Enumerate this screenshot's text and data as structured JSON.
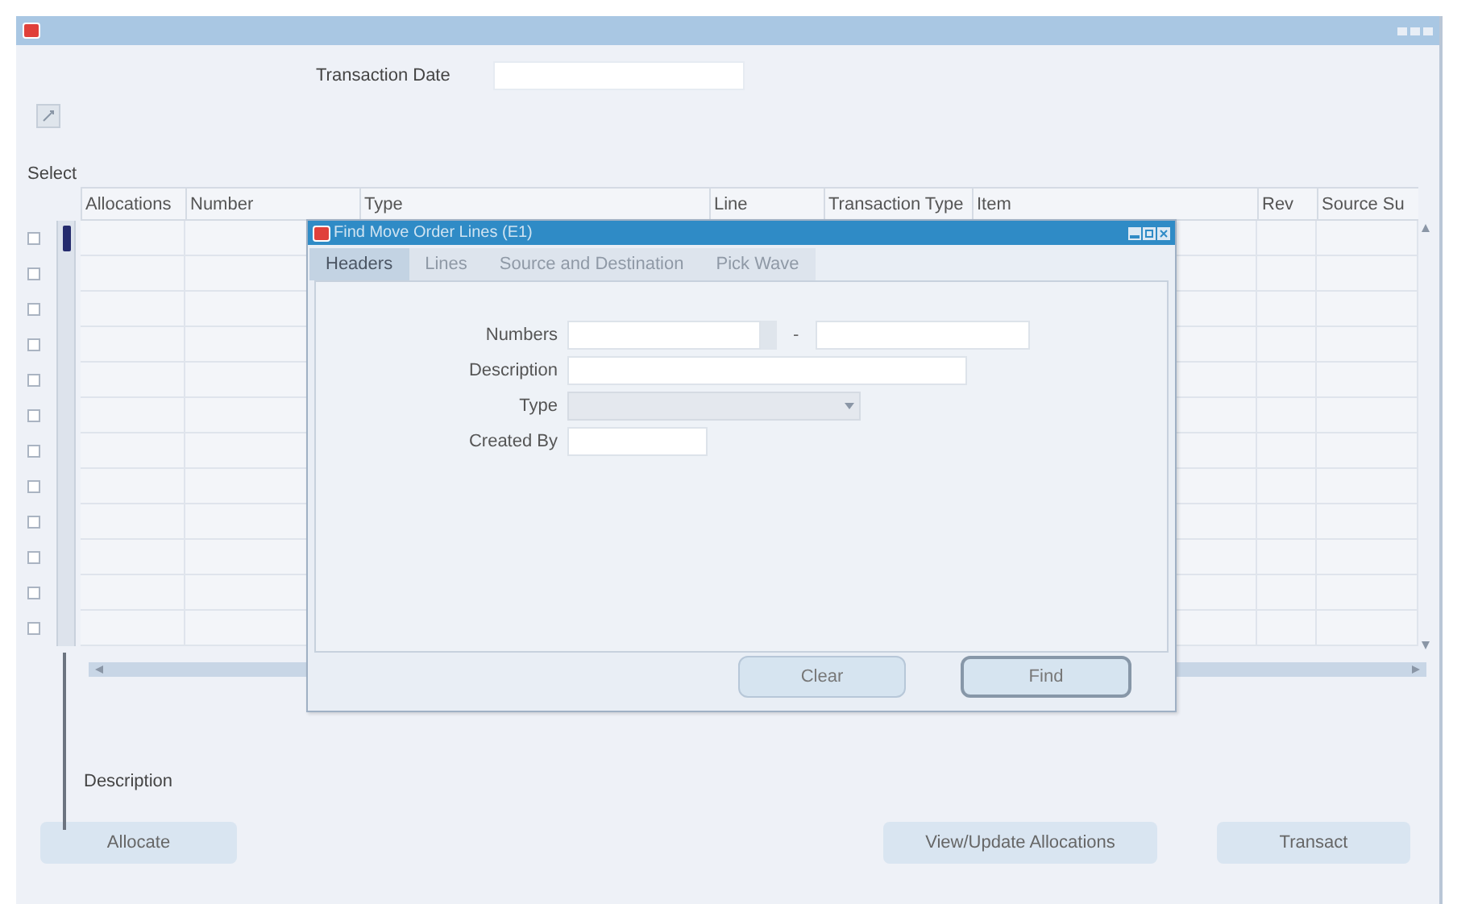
{
  "transaction_date": {
    "label": "Transaction Date"
  },
  "select_label": "Select",
  "table": {
    "columns": [
      "Allocations",
      "Number",
      "Type",
      "Line",
      "Transaction Type",
      "Item",
      "Rev",
      "Source Su"
    ],
    "rows": [
      {
        "checked": false,
        "selected": true
      },
      {
        "checked": false,
        "selected": false
      },
      {
        "checked": false,
        "selected": false
      },
      {
        "checked": false,
        "selected": false
      },
      {
        "checked": false,
        "selected": false
      },
      {
        "checked": false,
        "selected": false
      },
      {
        "checked": false,
        "selected": false
      },
      {
        "checked": false,
        "selected": false
      },
      {
        "checked": false,
        "selected": false
      },
      {
        "checked": false,
        "selected": false
      },
      {
        "checked": false,
        "selected": false
      },
      {
        "checked": false,
        "selected": false
      }
    ]
  },
  "description_label": "Description",
  "buttons": [
    {
      "label": "Allocate"
    },
    {
      "label": "View/Update Allocations"
    },
    {
      "label": "Transact"
    }
  ],
  "dialog": {
    "title": "Find Move Order Lines (E1)",
    "tabs": [
      {
        "label": "Headers",
        "selected": true
      },
      {
        "label": "Lines",
        "selected": false
      },
      {
        "label": "Source and Destination",
        "selected": false
      },
      {
        "label": "Pick Wave",
        "selected": false
      }
    ],
    "fields": [
      {
        "label": "Numbers",
        "kind": "range",
        "separator": "-"
      },
      {
        "label": "Description",
        "kind": "text"
      },
      {
        "label": "Type",
        "kind": "select"
      },
      {
        "label": "Created By",
        "kind": "text"
      }
    ],
    "buttons": [
      {
        "label": "Clear",
        "default": false
      },
      {
        "label": "Find",
        "default": true
      }
    ]
  }
}
